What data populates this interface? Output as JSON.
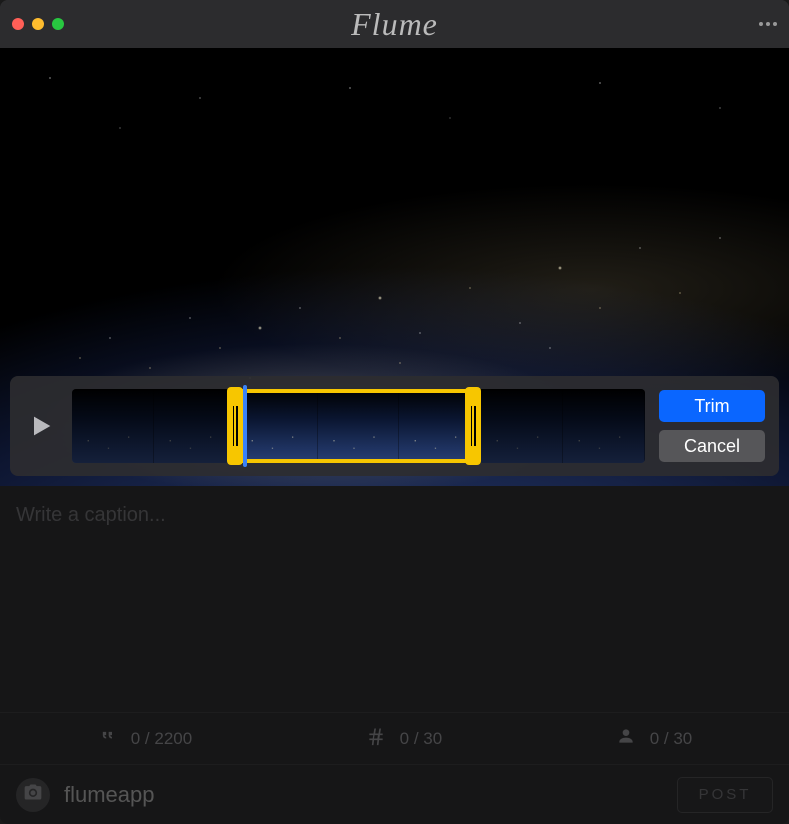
{
  "app": {
    "title": "Flume"
  },
  "trim": {
    "trim_label": "Trim",
    "cancel_label": "Cancel"
  },
  "caption": {
    "placeholder": "Write a caption..."
  },
  "counts": {
    "caption_count": "0 / 2200",
    "hashtag_count": "0 / 30",
    "mention_count": "0 / 30"
  },
  "footer": {
    "username": "flumeapp",
    "post_label": "Post"
  }
}
